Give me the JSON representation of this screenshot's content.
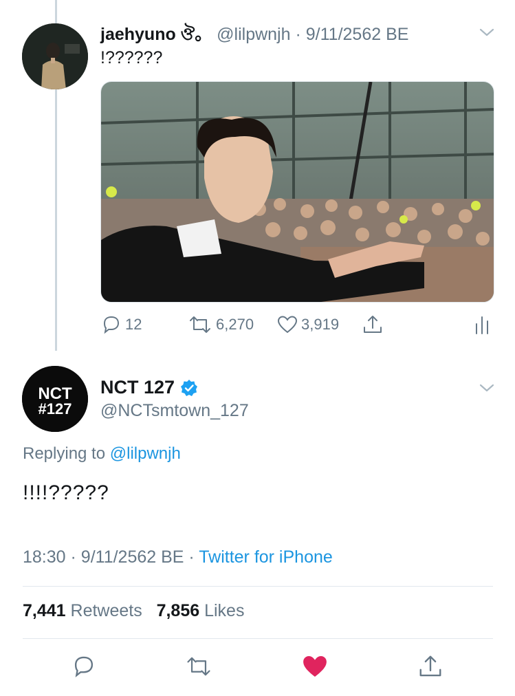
{
  "tweet1": {
    "display_name": "jaehyuno ঔ。",
    "handle": "@lilpwnjh",
    "date": "9/11/2562 BE",
    "text": "!??????",
    "replies": "12",
    "retweets": "6,270",
    "likes": "3,919"
  },
  "tweet2": {
    "display_name": "NCT 127",
    "handle": "@NCTsmtown_127",
    "avatar_text_top": "NCT",
    "avatar_text_bottom": "#127",
    "replying_prefix": "Replying to",
    "replying_to": "@lilpwnjh",
    "text": "!!!!?????",
    "time": "18:30",
    "date": "9/11/2562 BE",
    "source": "Twitter for iPhone",
    "retweet_count": "7,441",
    "retweet_label": "Retweets",
    "like_count": "7,856",
    "like_label": "Likes"
  },
  "icons": {
    "reply": "reply-icon",
    "retweet": "retweet-icon",
    "like": "heart-icon",
    "share": "share-icon",
    "analytics": "analytics-icon",
    "verified": "verified-badge-icon",
    "chevron": "chevron-down-icon"
  },
  "colors": {
    "link": "#1b95e0",
    "secondary_text": "#657786",
    "like_active": "#e0245e",
    "verified": "#1da1f2"
  }
}
